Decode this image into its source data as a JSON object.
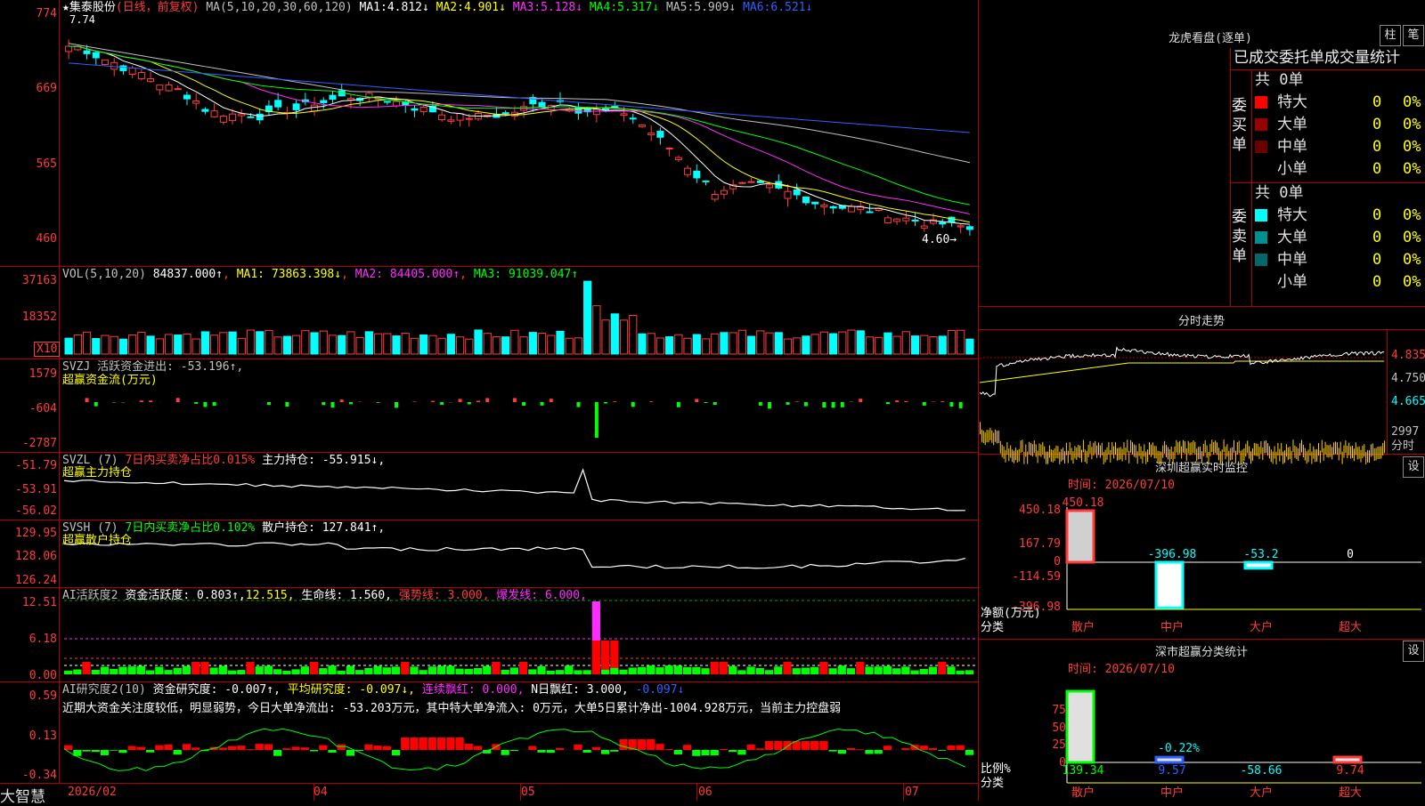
{
  "stock": {
    "name": "集泰股份",
    "mode": "(日线，前复权)",
    "ma_header": "MA(5,10,20,30,60,120)",
    "ma_values": [
      {
        "label": "MA1:",
        "value": "4.812↓",
        "color": "#ffffff"
      },
      {
        "label": "MA2:",
        "value": "4.901↓",
        "color": "#ffff00"
      },
      {
        "label": "MA3:",
        "value": "5.128↓",
        "color": "#ff2dff"
      },
      {
        "label": "MA4:",
        "value": "5.317↓",
        "color": "#00ff00"
      },
      {
        "label": "MA5:",
        "value": "5.909↓",
        "color": "#c0c0c0"
      },
      {
        "label": "MA6:",
        "value": "6.521↓",
        "color": "#3060ff"
      }
    ],
    "high_marker": "7.74",
    "low_marker": "4.60→"
  },
  "axes": {
    "price": [
      "774",
      "669",
      "565",
      "460"
    ],
    "vol": [
      "37163",
      "18352"
    ],
    "vol_unit": "X10",
    "svzj": [
      "1579",
      "-604",
      "-2787"
    ],
    "svzl": [
      "-51.79",
      "-53.91",
      "-56.02"
    ],
    "svsh": [
      "129.95",
      "128.06",
      "126.24"
    ],
    "ai": [
      "12.51",
      "6.18",
      "0.00"
    ],
    "ai2": [
      "0.59",
      "0.13",
      "-0.34"
    ]
  },
  "vol_line": {
    "text": "VOL(5,10,20)",
    "value": "84837.000↑",
    "ma1": "MA1: 73863.398↓",
    "ma2": "MA2: 84405.000↑",
    "ma3": "MA3: 91039.047↑"
  },
  "svzj_line": {
    "text": "SVZJ  活跃资金进出: -53.196↑,",
    "sub": "超赢资金流(万元)"
  },
  "svzl_line": {
    "a": "SVZL (7)",
    "b": "7日内买卖净占比0.015%",
    "c": "主力持仓: -55.915↓,",
    "sub": "超赢主力持仓"
  },
  "svsh_line": {
    "a": "SVSH (7)",
    "b": "7日内买卖净占比0.102%",
    "c": "散户持仓: 127.841↑,",
    "sub": "超赢散户持仓"
  },
  "ai_line": {
    "a": "AI活跃度2",
    "b": "资金活跃度: 0.803↑,",
    "c": "12.515,",
    "d": "生命线: 1.560,",
    "e": "强势线: 3.000,",
    "f": "爆发线: 6.000,"
  },
  "ai2_line": {
    "a": "AI研究度2(10)",
    "b": "资金研究度: -0.007↑,",
    "c": "平均研究度: -0.097↓,",
    "d": "连续飘红: 0.000,",
    "e": "N日飘红: 3.000,",
    "f": "-0.097↓"
  },
  "ai2_comment": "近期大资金关注度较低，明显弱势，今日大单净流出: -53.203万元，其中特大单净流入: 0万元，大单5日累计净出-1004.928万元，当前主力控盘弱",
  "xaxis": {
    "brand": "大智慧",
    "labels": [
      "2026/02",
      "04",
      "05",
      "06",
      "07"
    ]
  },
  "right": {
    "lhb_title": "龙虎看盘(逐单)",
    "btn1": "柱",
    "btn2": "笔",
    "tabs_text": "已成交委托单成交量统计",
    "buy": {
      "side": "委买单",
      "total": "共 0单",
      "rows": [
        {
          "label": "特大",
          "count": "0",
          "pct": "0%",
          "color": "#ff0000"
        },
        {
          "label": "大单",
          "count": "0",
          "pct": "0%",
          "color": "#9a0000"
        },
        {
          "label": "中单",
          "count": "0",
          "pct": "0%",
          "color": "#6a0000"
        },
        {
          "label": "小单",
          "count": "0",
          "pct": "0%",
          "color": "#000000"
        }
      ]
    },
    "sell": {
      "side": "委卖单",
      "total": "共 0单",
      "rows": [
        {
          "label": "特大",
          "count": "0",
          "pct": "0%",
          "color": "#00ffff"
        },
        {
          "label": "大单",
          "count": "0",
          "pct": "0%",
          "color": "#009090"
        },
        {
          "label": "中单",
          "count": "0",
          "pct": "0%",
          "color": "#006868"
        },
        {
          "label": "小单",
          "count": "0",
          "pct": "0%",
          "color": "#000000"
        }
      ]
    },
    "intraday_title": "分时走势",
    "intraday_axis": [
      "4.835",
      "4.750",
      "4.665"
    ],
    "intraday_vol": [
      "2997",
      "分时"
    ],
    "sz_monitor": {
      "title": "深圳超赢实时监控",
      "btn": "设",
      "time": "时间: 2026/07/10",
      "axis": [
        "450.18",
        "167.79",
        "0",
        "-114.59",
        "-396.98"
      ],
      "bars": [
        {
          "cat": "散户",
          "value": 450.18,
          "label": "450.18",
          "label_color": "#ff3b3b"
        },
        {
          "cat": "中户",
          "value": -396.98,
          "label": "-396.98",
          "label_color": "#00ffff"
        },
        {
          "cat": "大户",
          "value": -53.2,
          "label": "-53.2",
          "label_color": "#00ffff"
        },
        {
          "cat": "超大",
          "value": 0,
          "label": "0",
          "label_color": "#ffffff"
        }
      ],
      "ylabel1": "净额(万元)",
      "ylabel2": "分类"
    },
    "sz_stats": {
      "title": "深市超赢分类统计",
      "btn": "设",
      "time": "时间: 2026/07/10",
      "axis": [
        "75",
        "50",
        "25",
        "0"
      ],
      "bars": [
        {
          "cat": "散户",
          "value": 139.34,
          "label": "139.34",
          "label_color": "#00ff00"
        },
        {
          "cat": "中户",
          "value": 9.57,
          "label": "9.57",
          "label_color": "#3060ff"
        },
        {
          "cat": "大户",
          "value": -58.66,
          "label": "-58.66",
          "label_color": "#00ffff"
        },
        {
          "cat": "超大",
          "value": 9.74,
          "label": "9.74",
          "label_color": "#ff3b3b"
        }
      ],
      "note": "-0.22%",
      "ylabel1": "比例%",
      "ylabel2": "分类"
    }
  },
  "colors": {
    "grid": "#b00000",
    "up": "#ff3b3b",
    "down": "#00ffff"
  }
}
